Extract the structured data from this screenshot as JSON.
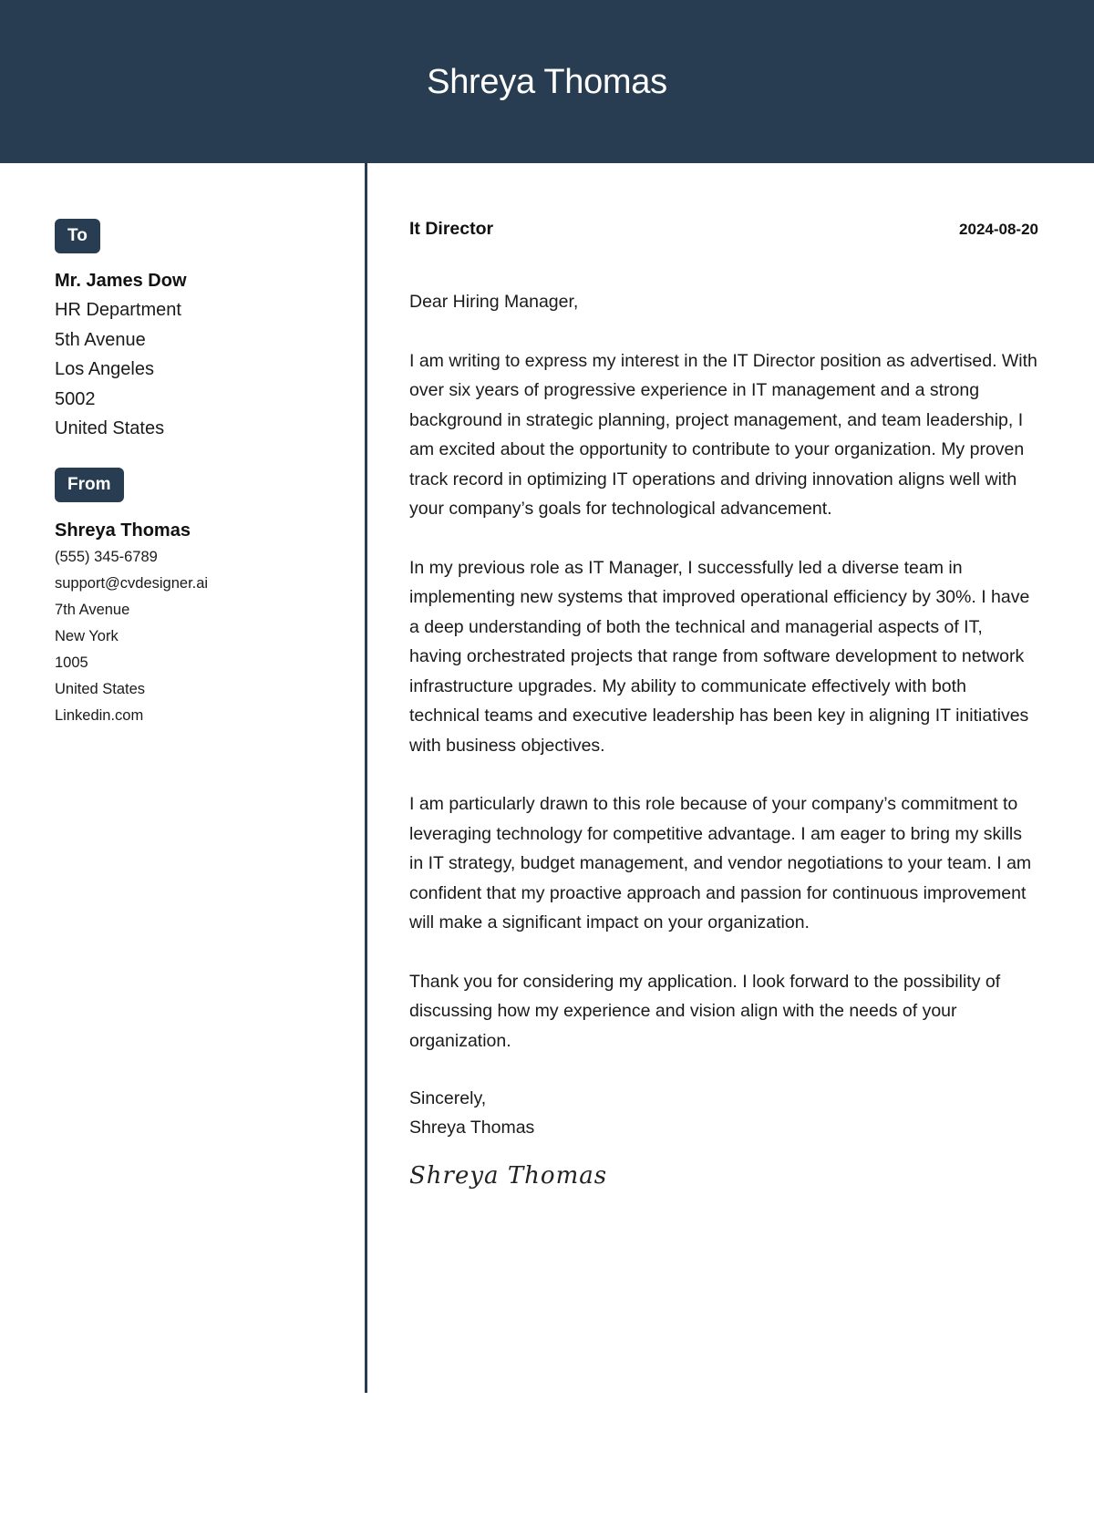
{
  "header": {
    "name": "Shreya Thomas"
  },
  "colors": {
    "accent": "#283c52",
    "text": "#1a1a1a",
    "background": "#ffffff"
  },
  "recipient": {
    "label": "To",
    "name": "Mr. James Dow",
    "lines": [
      "HR Department",
      "5th Avenue",
      "Los Angeles",
      "5002",
      "United States"
    ]
  },
  "sender": {
    "label": "From",
    "name": "Shreya Thomas",
    "lines": [
      "(555) 345-6789",
      "support@cvdesigner.ai",
      "7th Avenue",
      "New York",
      "1005",
      "United States",
      "Linkedin.com"
    ]
  },
  "letter": {
    "job_title": "It Director",
    "date": "2024-08-20",
    "greeting": "Dear Hiring Manager,",
    "paragraphs": [
      "I am writing to express my interest in the IT Director position as advertised. With over six years of progressive experience in IT management and a strong background in strategic planning, project management, and team leadership, I am excited about the opportunity to contribute to your organization. My proven track record in optimizing IT operations and driving innovation aligns well with your company’s goals for technological advancement.",
      "In my previous role as IT Manager, I successfully led a diverse team in implementing new systems that improved operational efficiency by 30%. I have a deep understanding of both the technical and managerial aspects of IT, having orchestrated projects that range from software development to network infrastructure upgrades. My ability to communicate effectively with both technical teams and executive leadership has been key in aligning IT initiatives with business objectives.",
      "I am particularly drawn to this role because of your company’s commitment to leveraging technology for competitive advantage. I am eager to bring my skills in IT strategy, budget management, and vendor negotiations to your team. I am confident that my proactive approach and passion for continuous improvement will make a significant impact on your organization.",
      "Thank you for considering my application. I look forward to the possibility of discussing how my experience and vision align with the needs of your organization."
    ],
    "closing": "Sincerely,",
    "closing_name": "Shreya Thomas",
    "signature": "Shreya Thomas"
  }
}
